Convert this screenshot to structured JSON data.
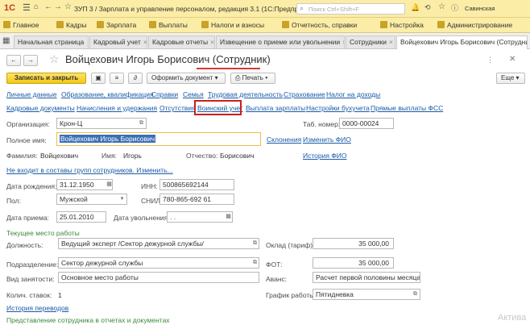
{
  "title": {
    "logo": "1С",
    "app": "ЗУП 3 / Зарплата и управление персоналом, редакция 3.1  (1С:Предприятие)",
    "search_placeholder": "Поиск Ctrl+Shift+F",
    "user": "Савинская"
  },
  "nav": [
    "Главное",
    "Кадры",
    "Зарплата",
    "Выплаты",
    "Налоги и взносы",
    "Отчетность, справки",
    "Настройка",
    "Администрирование"
  ],
  "tabs": [
    "Начальная страница",
    "Кадровый учет",
    "Кадровые отчеты",
    "Извещение о приеме или увольнении",
    "Сотрудники",
    "Войцехович Игорь Борисович (Сотрудник)"
  ],
  "form": {
    "title": "Войцехович Игорь Борисович (Сотрудник)"
  },
  "toolbar": {
    "save": "Записать и закрыть",
    "doc": "Оформить документ",
    "print": "Печать"
  },
  "links1": [
    "Личные данные",
    "Образование, квалификация",
    "Справки",
    "Семья",
    "Трудовая деятельность",
    "Страхование",
    "Налог на доходы"
  ],
  "links2": [
    "Кадровые документы",
    "Начисления и удержания",
    "Отсутствия",
    "Воинский учет",
    "Выплата зарплаты",
    "Настройки бухучета",
    "Прямые выплаты ФСС"
  ],
  "fields": {
    "org_label": "Организация:",
    "org": "Крон-Ц",
    "tab_label": "Таб. номер:",
    "tab": "0000-00024",
    "fullname_label": "Полное имя:",
    "fullname": "Войцехович Игорь Борисович",
    "declensions": "Склонения",
    "change_fio": "Изменить ФИО",
    "surname_label": "Фамилия:",
    "surname": "Войцехович",
    "name_label": "Имя:",
    "name": "Игорь",
    "patr_label": "Отчество:",
    "patr": "Борисович",
    "fio_history": "История ФИО",
    "groups": "Не входит в составы групп сотрудников. Изменить...",
    "birth_label": "Дата рождения:",
    "birth": "31.12.1950",
    "inn_label": "ИНН:",
    "inn": "500865692144",
    "sex_label": "Пол:",
    "sex": "Мужской",
    "snils_label": "СНИЛС:",
    "snils": "780-865-692 61",
    "hire_label": "Дата приема:",
    "hire": "25.01.2010",
    "fire_label": "Дата увольнения:",
    "fire": " .  .",
    "section": "Текущее место работы",
    "pos_label": "Должность:",
    "pos": "Ведущий эксперт /Сектор дежурной службы/",
    "salary_label": "Оклад (тариф):",
    "salary": "35 000,00",
    "dept_label": "Подразделение:",
    "dept": "Сектор дежурной службы",
    "fot_label": "ФОТ:",
    "fot": "35 000,00",
    "emp_label": "Вид занятости:",
    "emp": "Основное место работы",
    "adv_label": "Аванс:",
    "adv": "Расчет первой половины месяца",
    "rates_label": "Колич. ставок:",
    "rates": "1",
    "sched_label": "График работы:",
    "sched": "Пятидневка",
    "transfers": "История переводов",
    "repr": "Представление сотрудника в отчетах и документах",
    "activate": "Актива"
  }
}
